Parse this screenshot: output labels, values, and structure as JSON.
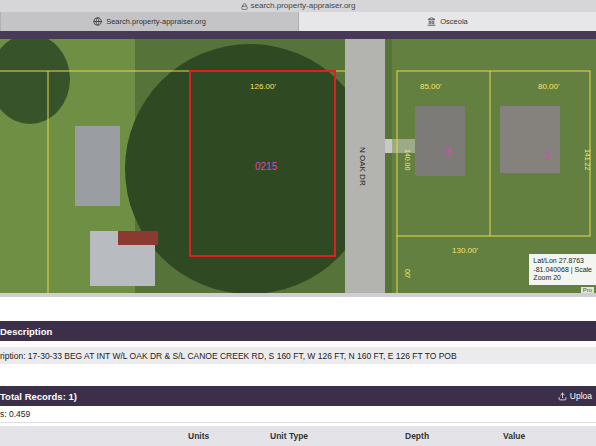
{
  "browser": {
    "url": "search.property-appraiser.org"
  },
  "tabs": [
    {
      "label": "Search.property-appraiser.org",
      "selected": false
    },
    {
      "label": "Osceola",
      "selected": true
    }
  ],
  "map": {
    "labels": {
      "parcel_front": "126.00'",
      "parcel_id": "0215",
      "road": "N OAK DR",
      "lot_3_front": "85.00'",
      "lot_2_front": "80.00'",
      "lot_3": "3",
      "lot_2": "2",
      "lot_3_depth": "140.00",
      "lot_2_depth": "141.22",
      "lot_rear": "130.00'",
      "lot_side": "00'"
    },
    "coordinates": [
      "Lat/Lon 27.8763",
      "-81.040068 | Scale",
      "Zoom 20"
    ],
    "attribution": "Pro"
  },
  "description": {
    "heading": "Description",
    "text": "ription: 17-30-33 BEG AT INT W/L OAK DR & S/L CANOE CREEK RD, S 160 FT, W 126 FT, N 160 FT, E 126 FT TO POB"
  },
  "records": {
    "heading": "Total Records: 1)",
    "upload": "Uploa",
    "acres": "s: 0.459",
    "columns": [
      "Units",
      "Unit Type",
      "Depth",
      "Value"
    ]
  }
}
